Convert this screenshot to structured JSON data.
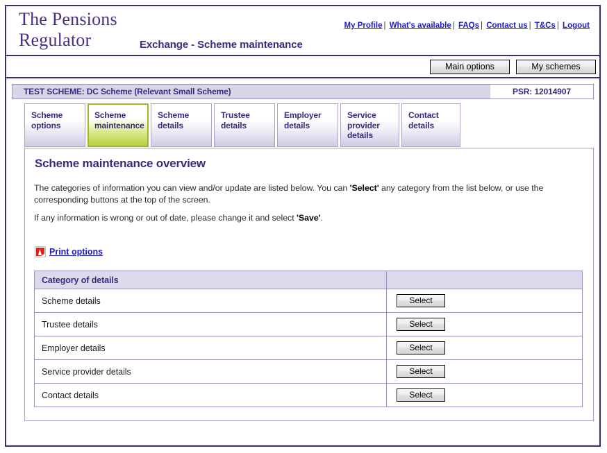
{
  "header": {
    "logo_text": "The Pensions\nRegulator",
    "app_title": "Exchange - Scheme maintenance",
    "nav_links": [
      {
        "label": "My Profile"
      },
      {
        "label": "What's available"
      },
      {
        "label": "FAQs"
      },
      {
        "label": "Contact us"
      },
      {
        "label": "T&Cs"
      },
      {
        "label": "Logout"
      }
    ],
    "nav_separator": "|"
  },
  "optionbar": {
    "main_options_label": "Main options",
    "my_schemes_label": "My schemes"
  },
  "scheme_bar": {
    "scheme_name": "TEST SCHEME: DC Scheme (Relevant Small Scheme)",
    "psr": "PSR: 12014907"
  },
  "tabs": [
    {
      "label": "Scheme\noptions",
      "active": false
    },
    {
      "label": "Scheme\nmaintenance",
      "active": true
    },
    {
      "label": "Scheme\ndetails",
      "active": false
    },
    {
      "label": "Trustee\ndetails",
      "active": false
    },
    {
      "label": "Employer\ndetails",
      "active": false
    },
    {
      "label": "Service\nprovider\ndetails",
      "active": false
    },
    {
      "label": "Contact\ndetails",
      "active": false
    }
  ],
  "panel": {
    "title": "Scheme maintenance overview",
    "paragraph_1_part_1": "The categories of information you can view and/or update are listed below. You can ",
    "paragraph_1_bold": "'Select'",
    "paragraph_1_part_2": " any category from the list below, or use the corresponding buttons at the top of the screen.",
    "paragraph_2_part_1": "If any information is wrong or out of date, please change it and select ",
    "paragraph_2_bold": "'Save'",
    "paragraph_2_part_2": ".",
    "print_link_label": "Print options"
  },
  "table": {
    "headers": {
      "category": "Category of details",
      "action": ""
    },
    "rows": [
      {
        "category": "Scheme details",
        "button_label": "Select"
      },
      {
        "category": "Trustee details",
        "button_label": "Select"
      },
      {
        "category": "Employer details",
        "button_label": "Select"
      },
      {
        "category": "Service provider details",
        "button_label": "Select"
      },
      {
        "category": "Contact details",
        "button_label": "Select"
      }
    ]
  },
  "colors": {
    "brand_purple": "#3b2a7d",
    "logo_purple": "#4b2d83",
    "link_blue": "#1a1acc",
    "accent_green": "#9fb82b",
    "lavender": "#d8d5e8",
    "table_header": "#ddd9ec",
    "border_purple": "#3d2a70",
    "border_light": "#9a93c0",
    "pdf_red": "#e02020"
  }
}
